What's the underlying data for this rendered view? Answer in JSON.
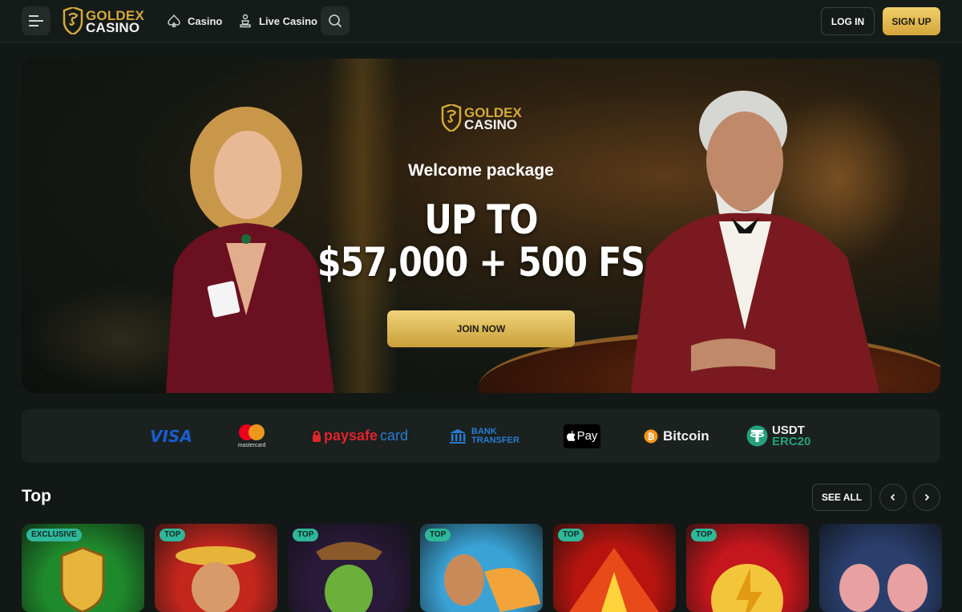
{
  "header": {
    "logo_line1": "GOLDEX",
    "logo_line2": "CASINO",
    "nav": [
      {
        "label": "Casino",
        "icon": "spade-icon"
      },
      {
        "label": "Live Casino",
        "icon": "dealer-icon"
      }
    ],
    "login_label": "LOG IN",
    "signup_label": "SIGN UP"
  },
  "banner": {
    "logo_line1": "GOLDEX",
    "logo_line2": "CASINO",
    "subtitle": "Welcome package",
    "headline_line1": "UP TO",
    "headline_line2": "$57,000 + 500 FS",
    "cta_label": "JOIN NOW"
  },
  "payments": {
    "visa": "VISA",
    "mastercard": "mastercard",
    "paysafe_a": "paysafe",
    "paysafe_b": "card",
    "bank_line1": "BANK",
    "bank_line2": "TRANSFER",
    "applepay": "Pay",
    "bitcoin": "Bitcoin",
    "usdt_line1": "USDT",
    "usdt_line2": "ERC20"
  },
  "games_section": {
    "title": "Top",
    "see_all_label": "SEE ALL",
    "tiles": [
      {
        "badge": "EXCLUSIVE",
        "bg": "#1f8a2c"
      },
      {
        "badge": "TOP",
        "bg": "#c2261d"
      },
      {
        "badge": "TOP",
        "bg": "#2a1a3a"
      },
      {
        "badge": "TOP",
        "bg": "#3aa3d6"
      },
      {
        "badge": "TOP",
        "bg": "#b8140f"
      },
      {
        "badge": "TOP",
        "bg": "#c4161c"
      },
      {
        "badge": "",
        "bg": "#2a3f6e"
      }
    ]
  },
  "colors": {
    "accent_gold": "#d4a93b",
    "badge_teal": "#2fb79a",
    "background": "#121816"
  }
}
